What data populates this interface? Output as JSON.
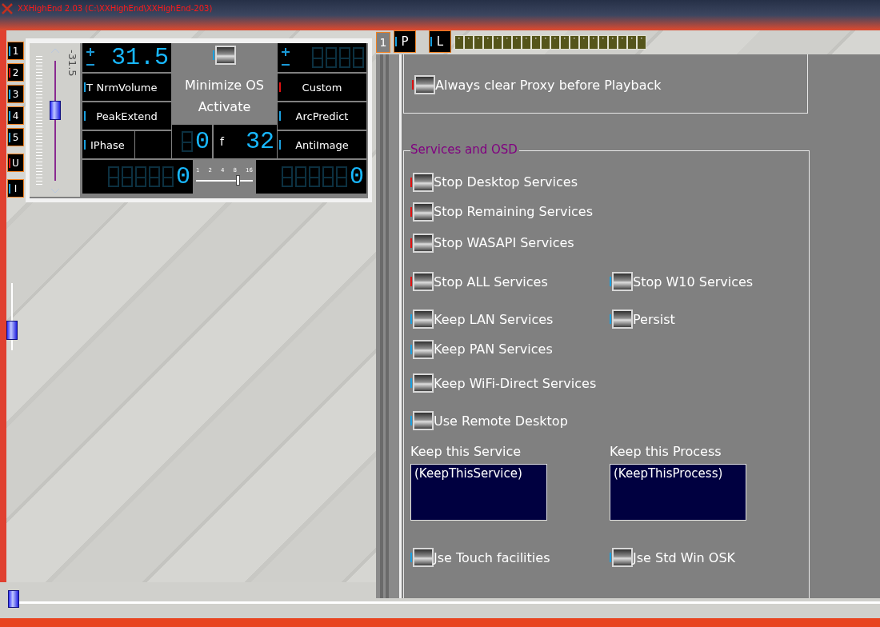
{
  "window": {
    "title": "XXHighEnd 2.03 (C:\\XXHighEnd\\XXHighEnd-203)"
  },
  "channel_buttons": [
    {
      "label": "1",
      "color": "#1aa0e0"
    },
    {
      "label": "2",
      "color": "#e01010"
    },
    {
      "label": "3",
      "color": "#1aa0e0"
    },
    {
      "label": "4",
      "color": "#1aa0e0"
    },
    {
      "label": "5",
      "color": "#1aa0e0"
    },
    {
      "label": "U",
      "color": "#e01010"
    },
    {
      "label": "I",
      "color": "#1aa0e0"
    }
  ],
  "side_slider": {
    "level": 0.3
  },
  "panel": {
    "volume_slider": {
      "level": 0.58,
      "reading": "-31.5"
    },
    "volume_display": {
      "value": "31.5"
    },
    "minimize_checkbox": {
      "color": "#1aa0e0",
      "checked": true
    },
    "minimize_label": "Minimize OS",
    "activate_label": "Activate",
    "left_buttons": [
      {
        "label": "NrmVolume",
        "prefix": "T",
        "color": "#1aa0e0"
      },
      {
        "label": "PeakExtend",
        "color": "#1aa0e0"
      },
      {
        "label": "IPhase",
        "color": "#1aa0e0"
      }
    ],
    "right_buttons": [
      {
        "label": "Custom",
        "color": "#e01010"
      },
      {
        "label": "ArcPredict",
        "color": "#1aa0e0"
      },
      {
        "label": "AntiImage",
        "color": "#1aa0e0"
      }
    ],
    "mid_display": {
      "value": "0"
    },
    "f_label": "f",
    "f_display": {
      "value": "32"
    },
    "left_counter": {
      "value": "0"
    },
    "right_counter": {
      "value": "0"
    },
    "rate_slider": {
      "ticks": [
        "1",
        "2",
        "4",
        "8",
        "16"
      ],
      "level": 0.75
    }
  },
  "strip": {
    "number": "1",
    "buttons": [
      {
        "label": "P",
        "color": "#1aa0e0"
      },
      {
        "label": "L",
        "color": "#1aa0e0"
      }
    ]
  },
  "options": [
    {
      "label": "Always clear Proxy before Playback",
      "color": "#e01010",
      "checked": true
    }
  ],
  "services": {
    "title": "Services and OSD",
    "rows": [
      [
        {
          "label": "Stop Desktop Services",
          "color": "#e01010",
          "checked": true
        }
      ],
      [
        {
          "label": "Stop Remaining Services",
          "color": "#e01010",
          "checked": true
        }
      ],
      [
        {
          "label": "Stop WASAPI Services",
          "color": "#e01010",
          "checked": true
        }
      ],
      [
        {
          "label": "Stop ALL Services",
          "color": "#e01010",
          "checked": true
        },
        {
          "label": "Stop W10 Services",
          "color": "#1aa0e0",
          "checked": true
        }
      ],
      [
        {
          "label": "Keep LAN Services",
          "color": "#1aa0e0",
          "checked": true
        },
        {
          "label": "Persist",
          "color": "#1aa0e0",
          "checked": true
        }
      ],
      [
        {
          "label": "Keep PAN Services",
          "color": "#1aa0e0",
          "checked": true
        }
      ],
      [
        {
          "label": "Keep WiFi-Direct Services",
          "color": "#1aa0e0",
          "checked": true
        }
      ],
      [
        {
          "label": "Use Remote Desktop",
          "color": "#1aa0e0",
          "checked": true
        }
      ]
    ],
    "fields": [
      {
        "label": "Keep this Service",
        "value": "(KeepThisService)"
      },
      {
        "label": "Keep this Process",
        "value": "(KeepThisProcess)"
      }
    ],
    "last_row": [
      {
        "label": "Jse Touch facilities",
        "color": "#1aa0e0",
        "checked": true
      },
      {
        "label": "Jse Std Win OSK",
        "color": "#1aa0e0",
        "checked": true
      }
    ]
  },
  "bottom_slider": {
    "level": 0
  }
}
